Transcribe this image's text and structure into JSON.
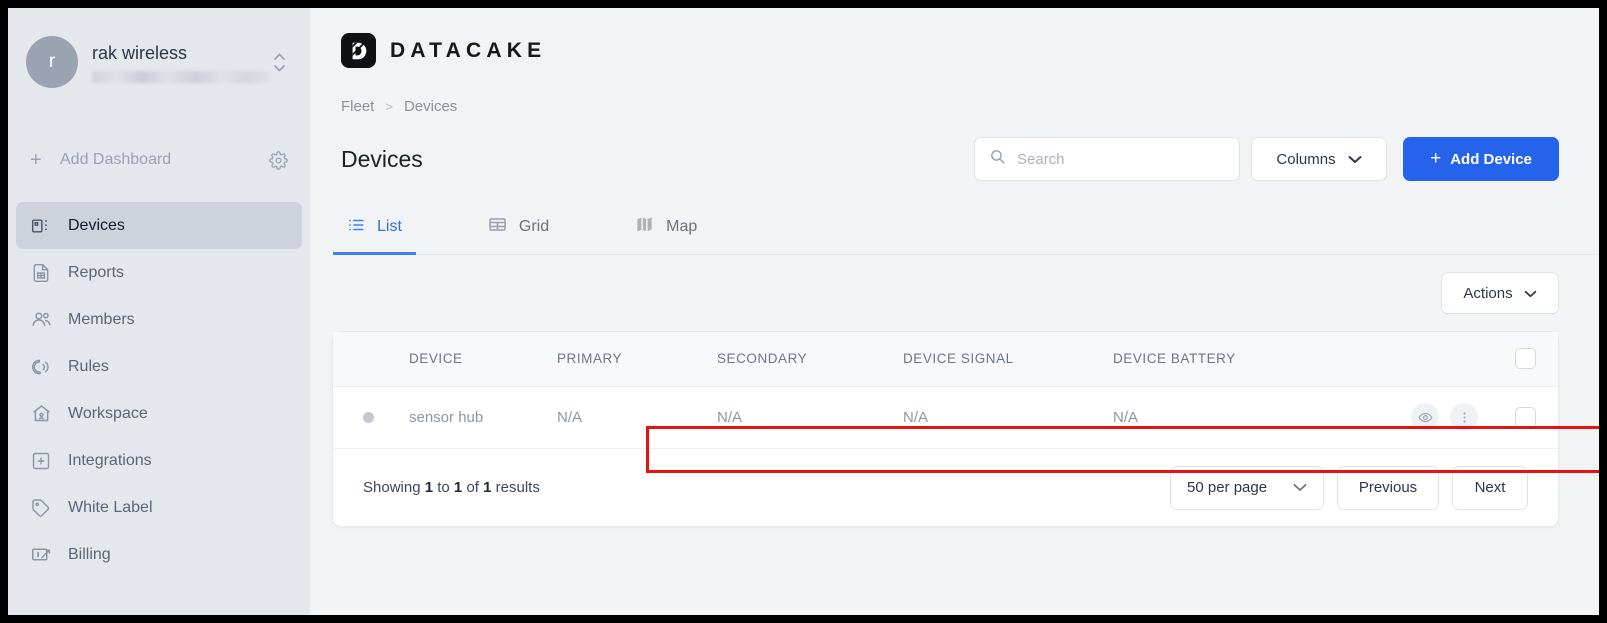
{
  "sidebar": {
    "org": {
      "avatar_letter": "r",
      "name": "rak wireless",
      "subtitle_redacted": ""
    },
    "add_dashboard": {
      "label": "Add Dashboard",
      "plus": "+"
    },
    "items": [
      {
        "label": "Devices",
        "icon": "devices-icon",
        "active": true
      },
      {
        "label": "Reports",
        "icon": "report-icon",
        "active": false
      },
      {
        "label": "Members",
        "icon": "members-icon",
        "active": false
      },
      {
        "label": "Rules",
        "icon": "rules-icon",
        "active": false
      },
      {
        "label": "Workspace",
        "icon": "workspace-icon",
        "active": false
      },
      {
        "label": "Integrations",
        "icon": "integrations-icon",
        "active": false
      },
      {
        "label": "White Label",
        "icon": "tag-icon",
        "active": false
      },
      {
        "label": "Billing",
        "icon": "billing-icon",
        "active": false
      }
    ]
  },
  "brand": {
    "name": "DATACAKE",
    "mark": "datacake-logo-icon"
  },
  "breadcrumb": {
    "root": "Fleet",
    "separator": ">",
    "current": "Devices"
  },
  "header": {
    "title": "Devices",
    "search": {
      "placeholder": "Search",
      "value": "",
      "icon": "search-icon"
    },
    "columns_button": {
      "label": "Columns",
      "icon": "chevron-down-icon"
    },
    "add_device_button": {
      "label": "Add Device",
      "plus": "+"
    }
  },
  "tabs": [
    {
      "label": "List",
      "icon": "list-icon",
      "active": true
    },
    {
      "label": "Grid",
      "icon": "grid-icon",
      "active": false
    },
    {
      "label": "Map",
      "icon": "map-icon",
      "active": false
    }
  ],
  "actions_button": {
    "label": "Actions",
    "icon": "chevron-down-icon"
  },
  "table": {
    "columns": [
      "",
      "DEVICE",
      "PRIMARY",
      "SECONDARY",
      "DEVICE SIGNAL",
      "DEVICE BATTERY",
      "",
      ""
    ],
    "rows": [
      {
        "status": "offline",
        "device": "sensor hub",
        "primary": "N/A",
        "secondary": "N/A",
        "device_signal": "N/A",
        "device_battery": "N/A",
        "view_icon": "eye-icon",
        "menu_icon": "kebab-menu-icon",
        "selected": false,
        "highlighted": true
      }
    ],
    "select_all": false
  },
  "footer": {
    "showing_prefix": "Showing",
    "from": "1",
    "mid": "to",
    "to": "1",
    "of": "of",
    "total": "1",
    "suffix": "results",
    "per_page": {
      "label": "50 per page",
      "icon": "chevron-down-icon"
    },
    "previous": "Previous",
    "next": "Next"
  },
  "colors": {
    "accent_blue": "#2563eb",
    "tab_active": "#3b82f6",
    "sidebar_bg": "#e4e7eb",
    "page_bg": "#f1f3f5",
    "annotation_red": "#e81111"
  }
}
